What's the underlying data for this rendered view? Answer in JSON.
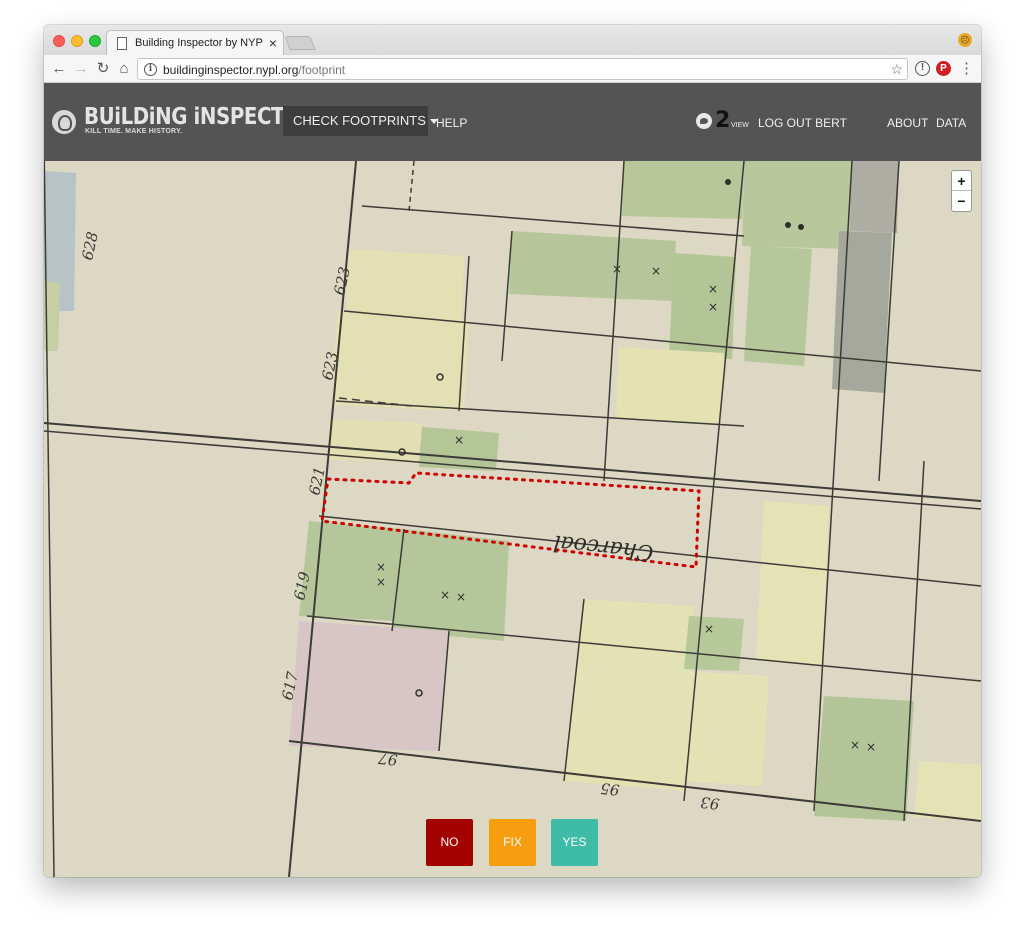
{
  "browser": {
    "tab_title": "Building Inspector by NYPL La",
    "tab_close": "×",
    "url_domain": "buildinginspector.nypl.org",
    "url_path": "/footprint"
  },
  "header": {
    "logo_title": "BUiLDiNG iNSPECTOR",
    "logo_tagline": "KILL TIME. MAKE HISTORY.",
    "check_menu_label": "CHECK FOOTPRINTS",
    "help_label": "HELP",
    "score_value": "2",
    "score_label": "VIEW",
    "logout_label": "LOG OUT BERT",
    "about_label": "ABOUT",
    "data_label": "DATA"
  },
  "map": {
    "zoom_in": "+",
    "zoom_out": "−",
    "lot_labels": [
      "628",
      "623",
      "623",
      "621",
      "619",
      "617",
      "97",
      "95",
      "93"
    ],
    "street_label": "Charcoal",
    "outline_color": "#cc0000"
  },
  "actions": {
    "no_label": "NO",
    "fix_label": "FIX",
    "yes_label": "YES",
    "no_color": "#a30000",
    "fix_color": "#f79e0e",
    "yes_color": "#3fbca7"
  }
}
